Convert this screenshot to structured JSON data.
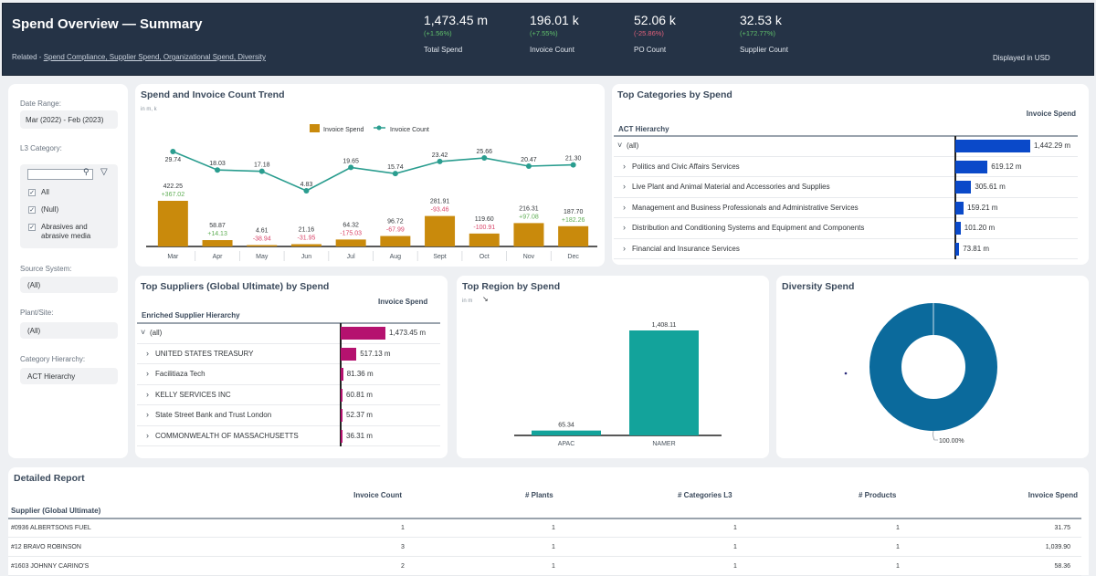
{
  "header": {
    "title": "Spend Overview — Summary",
    "related_prefix": "Related - ",
    "related_links": "Spend Compliance, Supplier Spend, Organizational Spend, Diversity ",
    "currency_note": "Displayed in USD",
    "kpis": [
      {
        "value": "1,473.45 m",
        "delta": "(+1.56%)",
        "trend": "up",
        "label": "Total Spend"
      },
      {
        "value": "196.01 k",
        "delta": "(+7.55%)",
        "trend": "up",
        "label": "Invoice Count"
      },
      {
        "value": "52.06 k",
        "delta": "(-25.86%)",
        "trend": "down",
        "label": "PO Count"
      },
      {
        "value": "32.53 k",
        "delta": "(+172.77%)",
        "trend": "up",
        "label": "Supplier Count"
      }
    ]
  },
  "filters": {
    "date_range": {
      "label": "Date Range:",
      "value": "Mar (2022) - Feb (2023)"
    },
    "l3_category": {
      "label": "L3 Category:",
      "search_placeholder": "",
      "options": [
        {
          "label": "All",
          "checked": true
        },
        {
          "label": "(Null)",
          "checked": true
        },
        {
          "label": "Abrasives and abrasive media",
          "checked": true
        }
      ]
    },
    "source_system": {
      "label": "Source System:",
      "value": "(All)"
    },
    "plant_site": {
      "label": "Plant/Site:",
      "value": "(All)"
    },
    "category_hierarchy": {
      "label": "Category Hierarchy:",
      "value": "ACT Hierarchy"
    }
  },
  "trend": {
    "title": "Spend and Invoice Count Trend",
    "units": "in m, k",
    "colors": {
      "spend": "#c98a0c",
      "count": "#2a9d8f"
    }
  },
  "top_categories": {
    "title": "Top Categories by Spend",
    "col_hierarchy": "ACT Hierarchy",
    "col_value": "Invoice Spend",
    "bar_color": "#0a49c9",
    "rows": [
      {
        "label": "(all)",
        "value": 1442.29,
        "display": "1,442.29 m",
        "expanded": true
      },
      {
        "label": "Politics and Civic Affairs Services",
        "value": 619.12,
        "display": "619.12 m"
      },
      {
        "label": "Live Plant and Animal Material and Accessories and Supplies",
        "value": 305.61,
        "display": "305.61 m"
      },
      {
        "label": "Management and Business Professionals and Administrative Services",
        "value": 159.21,
        "display": "159.21 m"
      },
      {
        "label": "Distribution and Conditioning Systems and Equipment and Components",
        "value": 101.2,
        "display": "101.20 m"
      },
      {
        "label": "Financial and Insurance Services",
        "value": 73.81,
        "display": "73.81 m"
      }
    ]
  },
  "top_suppliers": {
    "title": "Top Suppliers (Global Ultimate) by Spend",
    "col_hierarchy": "Enriched Supplier Hierarchy",
    "col_value": "Invoice Spend",
    "bar_color": "#b5126f",
    "rows": [
      {
        "label": "(all)",
        "value": 1473.45,
        "display": "1,473.45 m",
        "expanded": true
      },
      {
        "label": "UNITED STATES TREASURY",
        "value": 517.13,
        "display": "517.13 m"
      },
      {
        "label": "Facilitiaza Tech",
        "value": 81.36,
        "display": "81.36 m"
      },
      {
        "label": "KELLY SERVICES INC",
        "value": 60.81,
        "display": "60.81 m"
      },
      {
        "label": "State Street Bank and Trust London",
        "value": 52.37,
        "display": "52.37 m"
      },
      {
        "label": "COMMONWEALTH OF MASSACHUSETTS",
        "value": 36.31,
        "display": "36.31 m"
      }
    ]
  },
  "top_region": {
    "title": "Top Region by Spend",
    "units": "in m"
  },
  "diversity": {
    "title": "Diversity Spend"
  },
  "detailed_report": {
    "title": "Detailed Report",
    "columns": [
      "Supplier (Global Ultimate)",
      "Invoice Count",
      "# Plants",
      "# Categories L3",
      "# Products",
      "Invoice Spend"
    ],
    "rows": [
      [
        "#0936 ALBERTSONS FUEL",
        "1",
        "1",
        "1",
        "1",
        "31.75"
      ],
      [
        "#12 BRAVO ROBINSON",
        "3",
        "1",
        "1",
        "1",
        "1,039.90"
      ],
      [
        "#1603 JOHNNY CARINO'S",
        "2",
        "1",
        "1",
        "1",
        "58.36"
      ]
    ]
  },
  "chart_data": [
    {
      "type": "bar",
      "title": "Spend and Invoice Count Trend",
      "subtitle": "in m, k",
      "categories": [
        "Mar",
        "Apr",
        "May",
        "Jun",
        "Jul",
        "Aug",
        "Sept",
        "Oct",
        "Nov",
        "Dec"
      ],
      "legend": [
        "Invoice Spend",
        "Invoice Count"
      ],
      "legend_position": "top-center",
      "series": [
        {
          "name": "Invoice Spend",
          "type": "bar",
          "values": [
            422.25,
            58.87,
            4.61,
            21.16,
            64.32,
            96.72,
            281.91,
            119.6,
            216.31,
            187.7
          ],
          "labels": [
            "422.25",
            "58.87",
            "4.61",
            "21.16",
            "64.32",
            "96.72",
            "281.91",
            "119.60",
            "216.31",
            "187.70"
          ],
          "variance": [
            "+367.02",
            "+14.13",
            "-38.94",
            "-31.95",
            "-175.03",
            "-67.99",
            "-93.46",
            "-100.91",
            "+97.08",
            "+182.26"
          ]
        },
        {
          "name": "Invoice Count",
          "type": "line",
          "values": [
            29.74,
            18.03,
            17.18,
            4.83,
            19.65,
            15.74,
            23.42,
            25.66,
            20.47,
            21.3
          ],
          "labels": [
            "29.74",
            "18.03",
            "17.18",
            "4.83",
            "19.65",
            "15.74",
            "23.42",
            "25.66",
            "20.47",
            "21.30"
          ]
        }
      ],
      "grid": false
    },
    {
      "type": "bar",
      "title": "Top Region by Spend",
      "subtitle": "in m",
      "categories": [
        "APAC",
        "NAMER"
      ],
      "values": [
        65.34,
        1408.11
      ],
      "labels": [
        "65.34",
        "1,408.11"
      ],
      "color": "#13a39b",
      "grid": false
    },
    {
      "type": "pie",
      "title": "Diversity Spend",
      "slices": [
        {
          "label": "",
          "value": 100.0,
          "display": "100.00%"
        }
      ],
      "donut": true,
      "color": "#0b6a9c"
    }
  ]
}
